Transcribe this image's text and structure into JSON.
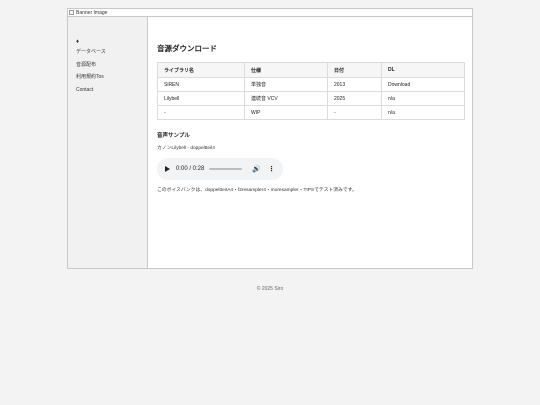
{
  "banner": {
    "alt_text": "Banner Image"
  },
  "sidebar": {
    "items": [
      {
        "label": "♦"
      },
      {
        "label": "データベース"
      },
      {
        "label": "音源配布"
      },
      {
        "label": "利用規約Tos"
      },
      {
        "label": "Contact"
      }
    ]
  },
  "main": {
    "title": "音源ダウンロード",
    "table": {
      "headers": [
        "ライブラリ名",
        "仕様",
        "日付",
        "DL"
      ],
      "rows": [
        [
          "SiREN",
          "単独音",
          "2013",
          "Download"
        ],
        [
          "Lilybell",
          "連続音 VCV",
          "2025",
          "n/a"
        ],
        [
          "-",
          "WIP",
          "-",
          "n/a"
        ]
      ]
    },
    "sample_heading": "音声サンプル",
    "sample_caption": "カノンLilybell - doppeltteil4",
    "player": {
      "time": "0:00 / 0:28",
      "progress": 0.0
    },
    "note": "このボイスバンクは、doppeltteiIA4・f2resampler4・moresampler・TIPSでテスト済みです。"
  },
  "footer": {
    "text": "© 2025 Siro"
  }
}
